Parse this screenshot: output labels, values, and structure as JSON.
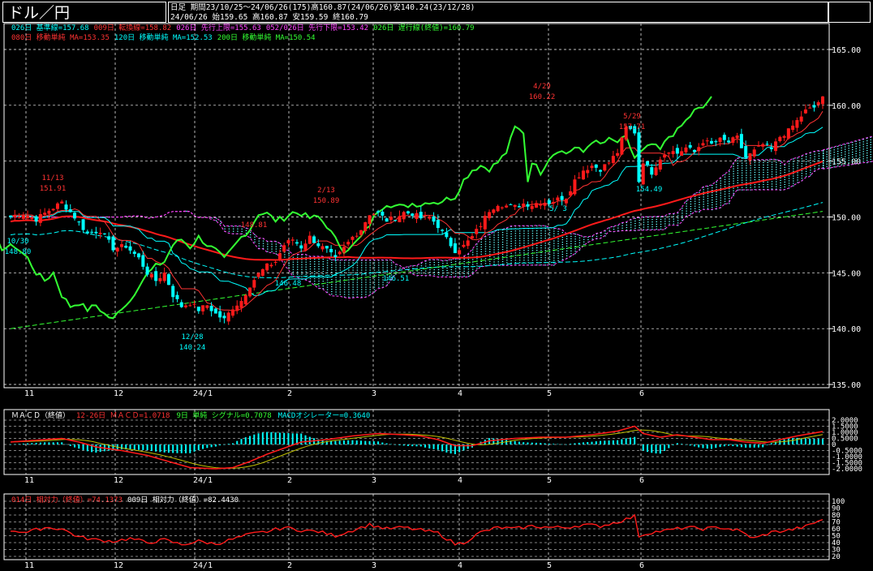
{
  "header": {
    "title": "ドル／円",
    "period_line": "日足  期間23/10/25〜24/06/26(175)高160.87(24/06/26)安140.24(23/12/28)",
    "ohlc_line": "24/06/26     始159.65 高160.87 安159.59 終160.79"
  },
  "legends": {
    "main_row1": [
      {
        "text": "026日 基準線=157.68",
        "color": "#00ffff"
      },
      {
        "text": "009日 転換線=158.82",
        "color": "#ff3333"
      },
      {
        "text": "026日 先行上限=155.63",
        "color": "#ff44ff"
      },
      {
        "text": "052/026日 先行下限=153.42",
        "color": "#ff44ff"
      },
      {
        "text": "026日 遅行線(終値)=160.79",
        "color": "#33ff33"
      }
    ],
    "main_row2": [
      {
        "text": "080日 移動単純 MA=153.35",
        "color": "#ff3333"
      },
      {
        "text": "120日 移動単純 MA=152.53",
        "color": "#00ffff"
      },
      {
        "text": "200日 移動単純 MA=150.54",
        "color": "#33ff33"
      }
    ],
    "macd": [
      {
        "text": "ＭＡＣＤ（終値）",
        "color": "#ffffff"
      },
      {
        "text": "12-26日 ＭＡＣＤ=1.0718",
        "color": "#ff3333"
      },
      {
        "text": "9日 単純 シグナル=0.7078",
        "color": "#33ff33"
      },
      {
        "text": "MACDオシレーター=0.3640",
        "color": "#00ffff"
      }
    ],
    "rsi": [
      {
        "text": "014日 相対力（終値）=74.1373",
        "color": "#ff3333"
      },
      {
        "text": "009日 相対力（終値）=82.4430",
        "color": "#ffffff"
      }
    ]
  },
  "colors": {
    "up": "#ff1a1a",
    "down": "#00ffff",
    "tenkan": "#ff3333",
    "kijun": "#00ffff",
    "chikou": "#33ff33",
    "span": "#ff44ff",
    "cloud": "#66ffff",
    "ma80": "#ff1a1a",
    "ma120": "#00ffff",
    "ma200": "#33ff33",
    "grid": "#ffffff",
    "axis": "#ffffff"
  },
  "chart_data": [
    {
      "type": "candlestick",
      "name": "main",
      "x_tick_labels": [
        "11",
        "12",
        "24/1",
        "2",
        "3",
        "4",
        "5",
        "6"
      ],
      "y_tick_labels": [
        "165.00",
        "160.00",
        "155.00",
        "150.00",
        "145.00",
        "140.00",
        "135.00"
      ],
      "ylim": [
        135,
        166.5
      ],
      "grid": true,
      "annotations": [
        {
          "label": "11/13",
          "value": "151.91",
          "color": "#ff3333"
        },
        {
          "label": "12/28",
          "value": "140.24",
          "color": "#00ffff"
        },
        {
          "label": "2/13",
          "value": "150.89",
          "color": "#ff3333"
        },
        {
          "label": "148.81",
          "value": "",
          "color": "#ff3333"
        },
        {
          "label": "4/29",
          "value": "160.22",
          "color": "#ff3333"
        },
        {
          "label": "5/ 3",
          "value": "",
          "color": "#00ffff"
        },
        {
          "label": "5/29",
          "value": "157.71",
          "color": "#ff3333"
        },
        {
          "label": "146.48",
          "value": "",
          "color": "#00ffff"
        },
        {
          "label": "146.51",
          "value": "",
          "color": "#00ffff"
        },
        {
          "label": "10/30",
          "value": "148.80",
          "color": "#00ffff"
        },
        {
          "label": "154.49",
          "value": "",
          "color": "#00ffff"
        }
      ],
      "close_path": [
        [
          0,
          150.0
        ],
        [
          3,
          150.3
        ],
        [
          6,
          149.8
        ],
        [
          9,
          150.6
        ],
        [
          12,
          151.3
        ],
        [
          15,
          150.0
        ],
        [
          18,
          148.5
        ],
        [
          21,
          148.8
        ],
        [
          24,
          147.2
        ],
        [
          27,
          147.4
        ],
        [
          30,
          146.3
        ],
        [
          32,
          145.0
        ],
        [
          34,
          144.3
        ],
        [
          36,
          145.0
        ],
        [
          38,
          143.0
        ],
        [
          40,
          142.0
        ],
        [
          42,
          142.3
        ],
        [
          44,
          141.7
        ],
        [
          46,
          142.1
        ],
        [
          48,
          141.3
        ],
        [
          50,
          140.8
        ],
        [
          52,
          141.9
        ],
        [
          54,
          142.5
        ],
        [
          56,
          143.9
        ],
        [
          58,
          144.9
        ],
        [
          60,
          145.6
        ],
        [
          62,
          146.0
        ],
        [
          64,
          147.5
        ],
        [
          66,
          148.0
        ],
        [
          68,
          147.3
        ],
        [
          70,
          148.2
        ],
        [
          72,
          147.5
        ],
        [
          74,
          147.0
        ],
        [
          76,
          146.2
        ],
        [
          78,
          147.2
        ],
        [
          80,
          148.2
        ],
        [
          82,
          148.9
        ],
        [
          84,
          150.3
        ],
        [
          86,
          150.3
        ],
        [
          88,
          149.7
        ],
        [
          90,
          149.9
        ],
        [
          92,
          150.4
        ],
        [
          94,
          150.3
        ],
        [
          96,
          149.9
        ],
        [
          98,
          150.0
        ],
        [
          100,
          149.2
        ],
        [
          102,
          148.0
        ],
        [
          104,
          147.0
        ],
        [
          106,
          147.4
        ],
        [
          108,
          148.2
        ],
        [
          110,
          149.3
        ],
        [
          112,
          150.6
        ],
        [
          114,
          151.2
        ],
        [
          116,
          151.0
        ],
        [
          118,
          150.9
        ],
        [
          120,
          151.2
        ],
        [
          122,
          151.1
        ],
        [
          124,
          151.4
        ],
        [
          126,
          151.3
        ],
        [
          128,
          151.6
        ],
        [
          130,
          151.8
        ],
        [
          132,
          153.3
        ],
        [
          134,
          154.2
        ],
        [
          136,
          154.6
        ],
        [
          138,
          154.3
        ],
        [
          140,
          154.9
        ],
        [
          142,
          155.8
        ],
        [
          144,
          158.0
        ],
        [
          146,
          157.6
        ],
        [
          147,
          153.2
        ],
        [
          148,
          155.0
        ],
        [
          150,
          154.0
        ],
        [
          152,
          155.3
        ],
        [
          154,
          156.0
        ],
        [
          156,
          155.7
        ],
        [
          158,
          156.2
        ],
        [
          160,
          155.8
        ],
        [
          162,
          156.8
        ],
        [
          164,
          156.5
        ],
        [
          166,
          156.9
        ],
        [
          168,
          156.7
        ],
        [
          170,
          157.1
        ],
        [
          172,
          155.3
        ],
        [
          174,
          155.9
        ],
        [
          176,
          156.5
        ],
        [
          178,
          156.0
        ],
        [
          180,
          157.2
        ],
        [
          182,
          157.7
        ],
        [
          184,
          158.6
        ],
        [
          186,
          159.5
        ],
        [
          188,
          159.8
        ],
        [
          190,
          160.8
        ]
      ],
      "series": [
        {
          "name": "009日 転換線",
          "color": "#ff3333"
        },
        {
          "name": "026日 基準線",
          "color": "#00ffff"
        },
        {
          "name": "026日 遅行線(終値)",
          "color": "#33ff33"
        },
        {
          "name": "080日 移動単純",
          "color": "#ff1a1a"
        },
        {
          "name": "120日 移動単純",
          "color": "#00ffff"
        },
        {
          "name": "200日 移動単純",
          "color": "#33ff33"
        }
      ]
    },
    {
      "type": "line",
      "name": "macd",
      "y_tick_labels": [
        "2.0000",
        "1.5000",
        "1.0000",
        "0.5000",
        "0",
        "-0.5000",
        "-1.0000",
        "-1.5000",
        "-2.0000"
      ],
      "ylim": [
        -2.2,
        2.2
      ],
      "values": [
        [
          0,
          0.2
        ],
        [
          6,
          0.35
        ],
        [
          12,
          0.5
        ],
        [
          16,
          0.2
        ],
        [
          20,
          -0.2
        ],
        [
          26,
          -0.5
        ],
        [
          32,
          -0.9
        ],
        [
          38,
          -1.5
        ],
        [
          42,
          -1.9
        ],
        [
          48,
          -2.0
        ],
        [
          52,
          -1.9
        ],
        [
          56,
          -1.4
        ],
        [
          60,
          -0.8
        ],
        [
          64,
          -0.3
        ],
        [
          68,
          0.2
        ],
        [
          74,
          0.4
        ],
        [
          80,
          0.7
        ],
        [
          86,
          0.9
        ],
        [
          92,
          0.8
        ],
        [
          96,
          0.7
        ],
        [
          100,
          0.4
        ],
        [
          104,
          -0.1
        ],
        [
          108,
          -0.1
        ],
        [
          112,
          0.3
        ],
        [
          118,
          0.5
        ],
        [
          124,
          0.6
        ],
        [
          130,
          0.6
        ],
        [
          136,
          0.8
        ],
        [
          142,
          1.1
        ],
        [
          146,
          1.5
        ],
        [
          148,
          0.9
        ],
        [
          152,
          0.6
        ],
        [
          156,
          0.8
        ],
        [
          160,
          0.6
        ],
        [
          164,
          0.4
        ],
        [
          168,
          0.4
        ],
        [
          172,
          0.2
        ],
        [
          176,
          0.1
        ],
        [
          180,
          0.4
        ],
        [
          184,
          0.7
        ],
        [
          190,
          1.07
        ]
      ]
    },
    {
      "type": "line",
      "name": "rsi",
      "y_tick_labels": [
        "100",
        "90",
        "80",
        "70",
        "60",
        "50",
        "40",
        "30",
        "20"
      ],
      "ylim": [
        18,
        101
      ],
      "values": [
        [
          0,
          58
        ],
        [
          4,
          55
        ],
        [
          8,
          62
        ],
        [
          12,
          60
        ],
        [
          16,
          48
        ],
        [
          20,
          44
        ],
        [
          24,
          42
        ],
        [
          28,
          46
        ],
        [
          32,
          40
        ],
        [
          36,
          44
        ],
        [
          40,
          37
        ],
        [
          44,
          42
        ],
        [
          48,
          38
        ],
        [
          52,
          45
        ],
        [
          56,
          52
        ],
        [
          60,
          56
        ],
        [
          64,
          62
        ],
        [
          68,
          58
        ],
        [
          72,
          56
        ],
        [
          76,
          50
        ],
        [
          80,
          58
        ],
        [
          84,
          66
        ],
        [
          88,
          60
        ],
        [
          92,
          62
        ],
        [
          96,
          58
        ],
        [
          100,
          54
        ],
        [
          104,
          38
        ],
        [
          106,
          40
        ],
        [
          110,
          55
        ],
        [
          114,
          62
        ],
        [
          118,
          60
        ],
        [
          122,
          64
        ],
        [
          126,
          62
        ],
        [
          130,
          62
        ],
        [
          134,
          66
        ],
        [
          138,
          64
        ],
        [
          142,
          70
        ],
        [
          146,
          78
        ],
        [
          147,
          50
        ],
        [
          150,
          55
        ],
        [
          154,
          58
        ],
        [
          158,
          62
        ],
        [
          162,
          60
        ],
        [
          166,
          62
        ],
        [
          170,
          58
        ],
        [
          174,
          46
        ],
        [
          178,
          55
        ],
        [
          182,
          58
        ],
        [
          186,
          63
        ],
        [
          190,
          74
        ]
      ]
    }
  ]
}
